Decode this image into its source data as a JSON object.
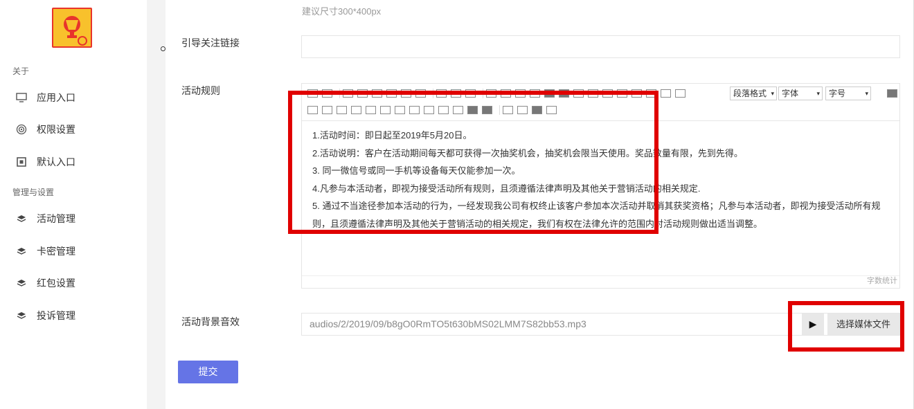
{
  "sidebar": {
    "sections": [
      {
        "title": "关于",
        "items": [
          {
            "label": "应用入口",
            "icon": "monitor-icon"
          },
          {
            "label": "权限设置",
            "icon": "target-icon"
          },
          {
            "label": "默认入口",
            "icon": "default-entry-icon"
          }
        ]
      },
      {
        "title": "管理与设置",
        "items": [
          {
            "label": "活动管理",
            "icon": "layers-icon"
          },
          {
            "label": "卡密管理",
            "icon": "layers-icon"
          },
          {
            "label": "红包设置",
            "icon": "layers-icon"
          },
          {
            "label": "投诉管理",
            "icon": "layers-icon"
          }
        ]
      }
    ]
  },
  "form": {
    "size_hint": "建议尺寸300*400px",
    "follow_link": {
      "label": "引导关注链接",
      "value": ""
    },
    "rules": {
      "label": "活动规则",
      "toolbar": {
        "paragraph_format": "段落格式",
        "font_family": "字体",
        "font_size": "字号"
      },
      "paragraphs": [
        "1.活动时间：即日起至2019年5月20日。",
        "2.活动说明：客户在活动期间每天都可获得一次抽奖机会，抽奖机会限当天使用。奖品数量有限，先到先得。",
        "3. 同一微信号或同一手机等设备每天仅能参加一次。",
        "4.凡参与本活动者，即视为接受活动所有规则，且须遵循法律声明及其他关于营销活动的相关规定.",
        "5. 通过不当途径参加本活动的行为，一经发现我公司有权终止该客户参加本次活动并取消其获奖资格；凡参与本活动者，即视为接受活动所有规则，且须遵循法律声明及其他关于营销活动的相关规定，我们有权在法律允许的范围内对活动规则做出适当调整。"
      ],
      "word_count_label": "字数统计"
    },
    "bg_music": {
      "label": "活动背景音效",
      "value": "audios/2/2019/09/b8gO0RmTO5t630bMS02LMM7S82bb53.mp3",
      "play_icon": "▶",
      "choose_label": "选择媒体文件"
    },
    "submit_label": "提交"
  },
  "colors": {
    "accent": "#6574e6",
    "highlight": "#e00000",
    "logo_red": "#e8342b",
    "logo_yellow": "#f8c12c"
  }
}
